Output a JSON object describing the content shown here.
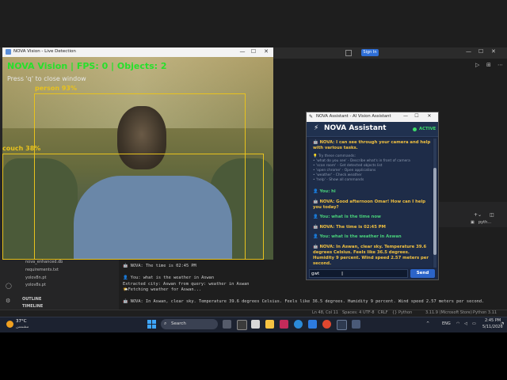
{
  "camera_window": {
    "title": "NOVA Vision - Live Detection",
    "hud": "NOVA Vision | FPS: 0 | Objects: 2",
    "hint": "Press 'q' to close window",
    "detections": [
      {
        "label": "person 93%"
      },
      {
        "label": "couch 38%"
      }
    ]
  },
  "assistant_window": {
    "title": "NOVA Assistant - AI Vision Assistant",
    "header": "NOVA Assistant",
    "status": "ACTIVE",
    "messages": {
      "m1": "🤖 NOVA: I can see through your camera and help with various tasks.",
      "hint_title": "💡 Try these commands:",
      "hint1": "• 'what do you see' - Describe what's in front of camera",
      "hint2": "• 'scan room' - Get detected objects list",
      "hint3": "• 'open chrome' - Open applications",
      "hint4": "• 'weather' - Check weather",
      "hint5": "• 'help' - Show all commands",
      "m2": "👤 You: hi",
      "m3": "🤖 NOVA: Good afternoon Omar! How can I help you today?",
      "m4": "👤 You: what is the time now",
      "m5": "🤖 NOVA: The time is 02:45 PM",
      "m6": "👤 You: what is the weather in Aswan",
      "m7": "🤖 NOVA: In Aswan, clear sky. Temperature 39.6 degrees Celsius. Feels like 36.5 degrees. Humidity 9 percent. Wind speed 2.57 meters per second."
    },
    "input_value": "gwt",
    "send_label": "Send"
  },
  "ide": {
    "signin_label": "Sign In",
    "explorer_items": [
      "nova_enhanced.db",
      "requirements.txt",
      "yolov8n.pt",
      "yolov8s.pt"
    ],
    "outline": [
      "OUTLINE",
      "TIMELINE"
    ],
    "right_panel": [
      "pyth..."
    ],
    "terminal_lines": [
      "🤖 NOVA: The time is 02:45 PM",
      "👤 You: what is the weather in Aswan",
      "Extracted city: Aswan from query: weather in Aswan",
      "🌤️Fetching weather for Aswan...",
      "🤖 NOVA: In Aswan, clear sky. Temperature 39.6 degrees Celsius. Feels like 36.5 degrees. Humidity 9 percent. Wind speed 2.57 meters per second."
    ],
    "status_items": [
      "Ln 48, Col 11",
      "Spaces: 4",
      "UTF-8",
      "CRLF",
      "{} Python",
      "3.11.9 (Microsoft Store)",
      "Python 3.11"
    ]
  },
  "taskbar": {
    "temperature": "37°C",
    "weather_desc": "مشمس",
    "search_label": "Search",
    "language": "ENG",
    "time": "2:45 PM",
    "date": "5/11/2026"
  },
  "colors": {
    "hud_green": "#27e02b",
    "bbox_yellow": "#e8c21d",
    "nova_text": "#f0c040",
    "user_text": "#48d07a",
    "active_green": "#3ddc6a",
    "send_blue": "#2c64c8"
  }
}
